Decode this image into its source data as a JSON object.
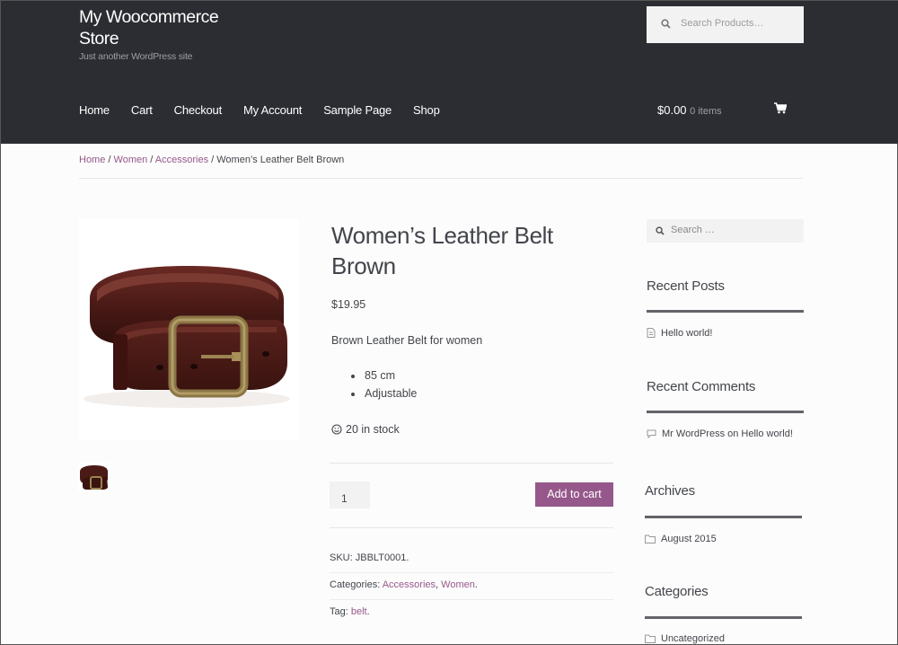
{
  "header": {
    "site_title": "My Woocommerce Store",
    "site_description": "Just another WordPress site",
    "search_placeholder": "Search Products…",
    "nav": [
      "Home",
      "Cart",
      "Checkout",
      "My Account",
      "Sample Page",
      "Shop"
    ],
    "cart_total": "$0.00",
    "cart_items": "0 items"
  },
  "breadcrumb": {
    "links": [
      "Home",
      "Women",
      "Accessories"
    ],
    "current": "Women’s Leather Belt Brown",
    "separator": " / "
  },
  "product": {
    "title": "Women’s Leather Belt Brown",
    "price": "$19.95",
    "short_description": "Brown Leather Belt for women",
    "features": [
      "85 cm",
      "Adjustable"
    ],
    "stock": "20 in stock",
    "quantity": "1",
    "add_to_cart_label": "Add to cart",
    "meta": {
      "sku_label": "SKU:",
      "sku": "JBBLT0001",
      "categories_label": "Categories:",
      "categories": [
        "Accessories",
        "Women"
      ],
      "tag_label": "Tag:",
      "tag": "belt"
    }
  },
  "sidebar": {
    "search_placeholder": "Search …",
    "recent_posts_title": "Recent Posts",
    "recent_posts": [
      "Hello world!"
    ],
    "recent_comments_title": "Recent Comments",
    "recent_comment": "Mr WordPress on Hello world!",
    "archives_title": "Archives",
    "archives": [
      "August 2015"
    ],
    "categories_title": "Categories",
    "categories": [
      "Uncategorized"
    ]
  },
  "colors": {
    "header_bg": "#2c2d33",
    "accent": "#96588a",
    "text": "#43454b"
  }
}
